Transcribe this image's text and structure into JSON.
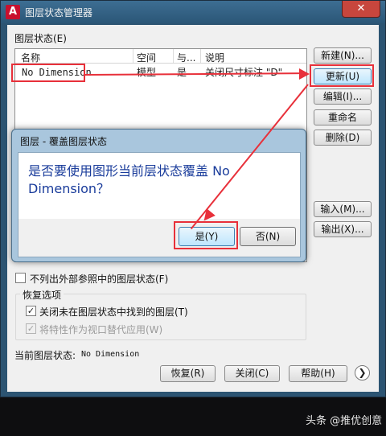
{
  "window": {
    "title": "图层状态管理器",
    "app_logo": "A",
    "close_glyph": "✕"
  },
  "layer_states": {
    "label": "图层状态(E)",
    "columns": [
      "名称",
      "空间",
      "与...",
      "说明"
    ],
    "rows": [
      {
        "name": "No Dimension",
        "space": "模型",
        "match": "是",
        "description": "关闭尺寸标注 \"D\""
      }
    ]
  },
  "side_buttons": {
    "new": "新建(N)...",
    "update": "更新(U)",
    "edit": "编辑(I)...",
    "rename": "重命名",
    "delete": "删除(D)",
    "import": "输入(M)...",
    "export": "输出(X)..."
  },
  "options": {
    "exclude_xref": {
      "label": "不列出外部参照中的图层状态(F)",
      "checked": false
    },
    "restore_group_label": "恢复选项",
    "turn_off_layers": {
      "label": "关闭未在图层状态中找到的图层(T)",
      "checked": true
    },
    "apply_viewport": {
      "label": "将特性作为视口替代应用(W)",
      "checked": true,
      "disabled": true
    }
  },
  "current_state": {
    "label": "当前图层状态:",
    "value": "No Dimension"
  },
  "bottom_buttons": {
    "restore": "恢复(R)",
    "close": "关闭(C)",
    "help": "帮助(H)",
    "more_glyph": "❯"
  },
  "dialog": {
    "title": "图层 - 覆盖图层状态",
    "message": "是否要使用图形当前层状态覆盖 No Dimension？",
    "yes": "是(Y)",
    "no": "否(N)"
  },
  "watermark": "头条 @推优创意",
  "colors": {
    "annotation_red": "#e8303a",
    "message_blue": "#1a3c9b",
    "titlebar_blue": "#2c5472"
  }
}
